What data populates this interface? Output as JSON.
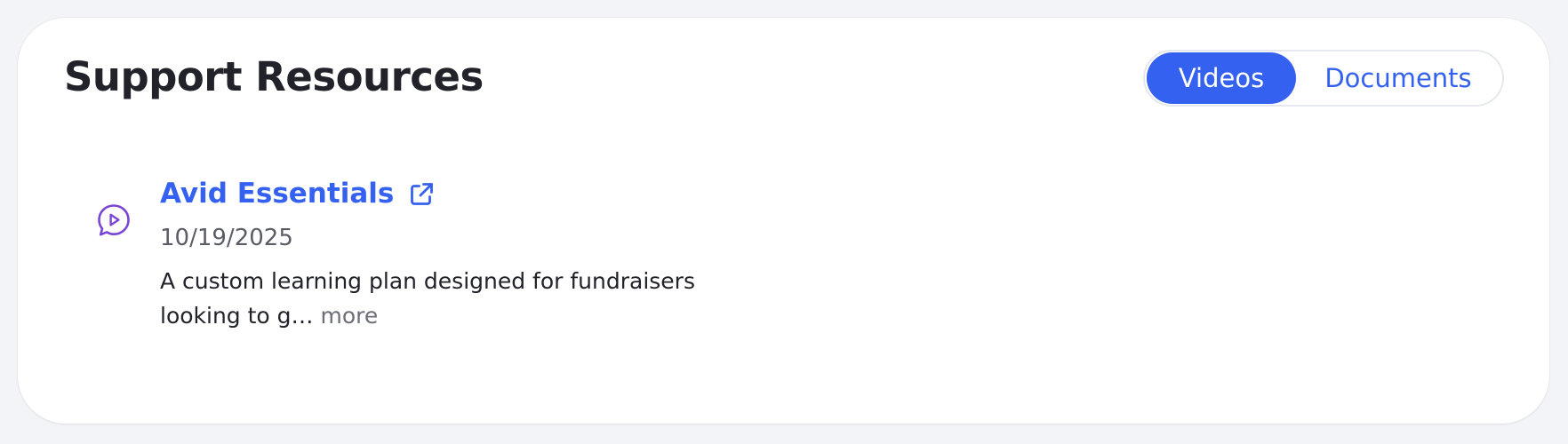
{
  "card": {
    "title": "Support Resources"
  },
  "tabs": {
    "videos_label": "Videos",
    "documents_label": "Documents",
    "selected": "Videos"
  },
  "resources": [
    {
      "icon": "video-chat-icon",
      "title": "Avid Essentials",
      "link_icon": "external-link-icon",
      "date": "10/19/2025",
      "description_lead": "A custom learning plan designed for fundraisers looking to g…",
      "more_label": "more"
    }
  ],
  "colors": {
    "accent": "#3561f0",
    "icon_purple": "#7a46d4",
    "title_text": "#22232a",
    "muted_text": "#5a5d66",
    "page_bg": "#f3f4f7",
    "card_bg": "#ffffff"
  }
}
